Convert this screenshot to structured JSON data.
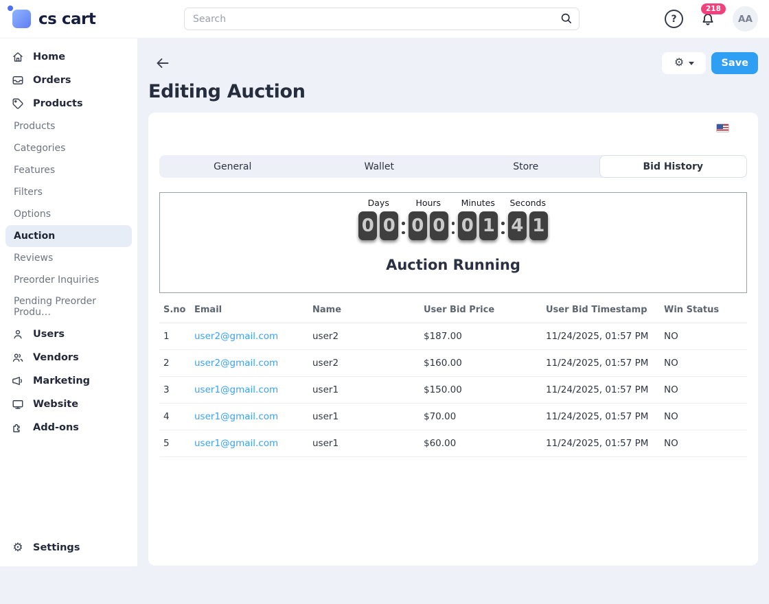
{
  "header": {
    "logo_text": "cs cart",
    "search_placeholder": "Search",
    "help_glyph": "?",
    "notification_count": "218",
    "avatar_initials": "AA"
  },
  "sidebar": {
    "primary_top": [
      {
        "label": "Home",
        "icon": "home-icon"
      },
      {
        "label": "Orders",
        "icon": "orders-icon"
      },
      {
        "label": "Products",
        "icon": "tag-icon"
      }
    ],
    "products_subitems": [
      "Products",
      "Categories",
      "Features",
      "Filters",
      "Options",
      "Auction",
      "Reviews",
      "Preorder Inquiries",
      "Pending Preorder Produ…"
    ],
    "active_item": "Auction",
    "primary_bottom": [
      {
        "label": "Users",
        "icon": "user-icon"
      },
      {
        "label": "Vendors",
        "icon": "users-icon"
      },
      {
        "label": "Marketing",
        "icon": "megaphone-icon"
      },
      {
        "label": "Website",
        "icon": "monitor-icon"
      },
      {
        "label": "Add-ons",
        "icon": "puzzle-icon"
      }
    ],
    "settings_label": "Settings"
  },
  "toolbar": {
    "save_label": "Save"
  },
  "page": {
    "title": "Editing Auction"
  },
  "tabs": [
    {
      "label": "General",
      "active": false
    },
    {
      "label": "Wallet",
      "active": false
    },
    {
      "label": "Store",
      "active": false
    },
    {
      "label": "Bid History",
      "active": true
    }
  ],
  "timer": {
    "labels": [
      "Days",
      "Hours",
      "Minutes",
      "Seconds"
    ],
    "digits": [
      "0",
      "0",
      "0",
      "0",
      "0",
      "1",
      "4",
      "1"
    ],
    "values": {
      "days": "00",
      "hours": "00",
      "minutes": "01",
      "seconds": "41"
    },
    "status_text": "Auction Running"
  },
  "bid_table": {
    "columns": [
      "S.no",
      "Email",
      "Name",
      "User Bid Price",
      "User Bid Timestamp",
      "Win Status"
    ],
    "rows": [
      {
        "sno": "1",
        "email": "user2@gmail.com",
        "name": "user2",
        "price": "$187.00",
        "timestamp": "11/24/2025, 01:57 PM",
        "win": "NO"
      },
      {
        "sno": "2",
        "email": "user2@gmail.com",
        "name": "user2",
        "price": "$160.00",
        "timestamp": "11/24/2025, 01:57 PM",
        "win": "NO"
      },
      {
        "sno": "3",
        "email": "user1@gmail.com",
        "name": "user1",
        "price": "$150.00",
        "timestamp": "11/24/2025, 01:57 PM",
        "win": "NO"
      },
      {
        "sno": "4",
        "email": "user1@gmail.com",
        "name": "user1",
        "price": "$70.00",
        "timestamp": "11/24/2025, 01:57 PM",
        "win": "NO"
      },
      {
        "sno": "5",
        "email": "user1@gmail.com",
        "name": "user1",
        "price": "$60.00",
        "timestamp": "11/24/2025, 01:57 PM",
        "win": "NO"
      }
    ]
  },
  "icons": {
    "gear_glyph": "⚙",
    "flag": "us-flag-icon"
  },
  "colors": {
    "accent_blue": "#2f9ff4",
    "link_blue": "#3aa1f8",
    "badge_pink": "#f2407c",
    "content_bg": "#eef1f8",
    "active_item_bg": "#e7edf6",
    "timer_digit_bg": "#3f3f3f",
    "logo_gradient_start": "#8fb5fb",
    "logo_gradient_end": "#5f7ef7"
  }
}
